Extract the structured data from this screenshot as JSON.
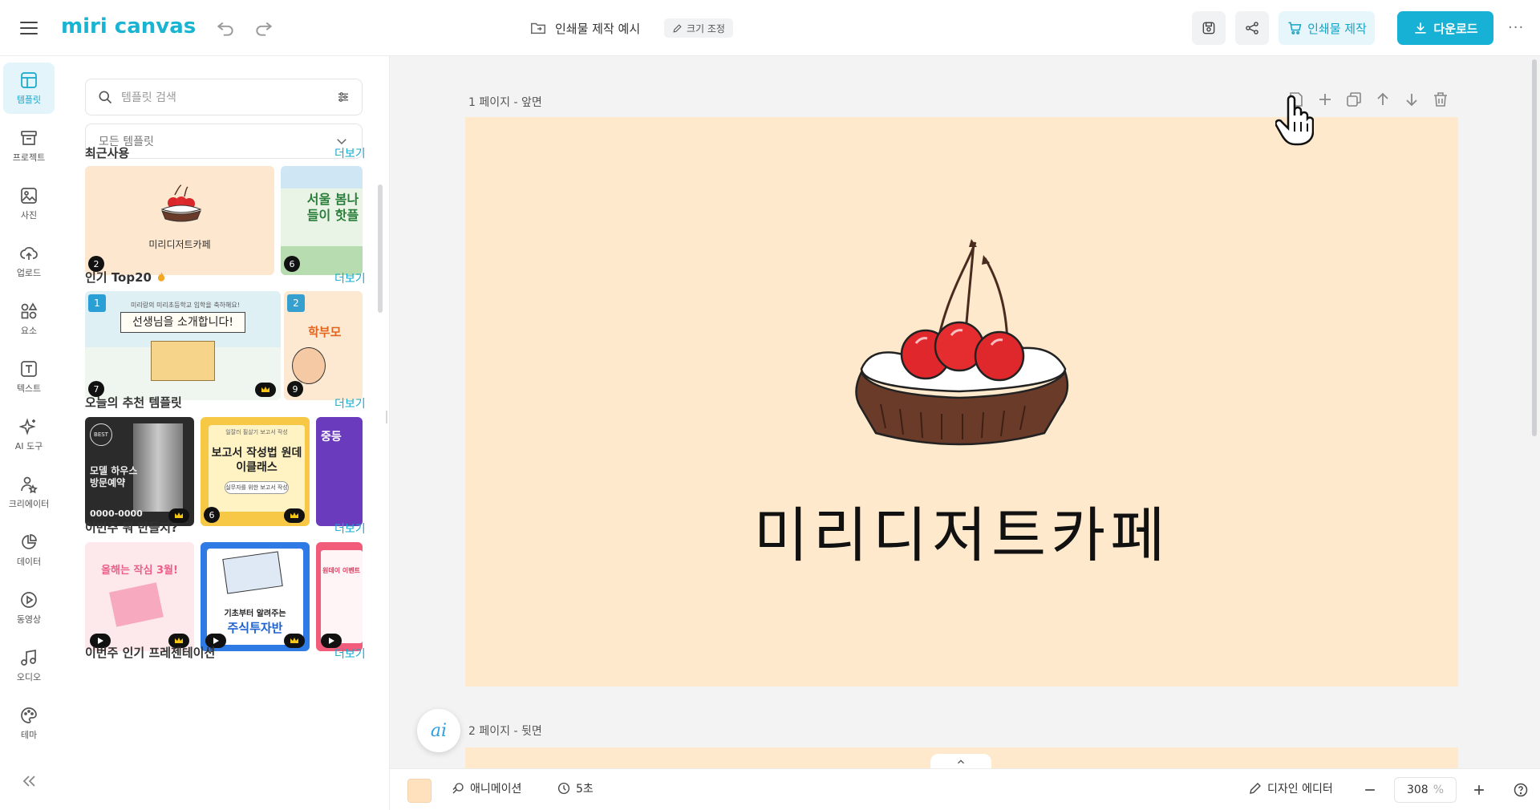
{
  "app": {
    "logo": "miri canvas",
    "doc_title": "인쇄물 제작 예시",
    "resize_label": "크기 조정",
    "print_label": "인쇄물 제작",
    "download_label": "다운로드",
    "more_label": "···"
  },
  "rail": {
    "items": [
      {
        "label": "템플릿",
        "icon": "template-icon",
        "active": true
      },
      {
        "label": "프로젝트",
        "icon": "project-icon"
      },
      {
        "label": "사진",
        "icon": "photo-icon"
      },
      {
        "label": "업로드",
        "icon": "upload-icon"
      },
      {
        "label": "요소",
        "icon": "elements-icon"
      },
      {
        "label": "텍스트",
        "icon": "text-icon"
      },
      {
        "label": "AI 도구",
        "icon": "ai-tools-icon"
      },
      {
        "label": "크리에이터",
        "icon": "creator-icon"
      },
      {
        "label": "데이터",
        "icon": "data-icon"
      },
      {
        "label": "동영상",
        "icon": "video-icon"
      },
      {
        "label": "오디오",
        "icon": "audio-icon"
      },
      {
        "label": "테마",
        "icon": "theme-icon"
      }
    ]
  },
  "panel": {
    "search_placeholder": "템플릿 검색",
    "dropdown_value": "모든 템플릿",
    "more_label": "더보기",
    "sections": [
      {
        "title": "최근사용"
      },
      {
        "title": "인기 Top20"
      },
      {
        "title": "오늘의 추천 템플릿"
      },
      {
        "title": "이번주 뭐 만들지?"
      },
      {
        "title": "이번주 인기 프레젠테이션"
      }
    ],
    "recent": [
      {
        "text": "미리디저트카페",
        "count": "2"
      },
      {
        "text": "서울 봄나들이 핫플",
        "count": "6"
      }
    ],
    "top20": [
      {
        "rank": "1",
        "subtitle": "미리랑의 미리초등학교 입학을 축하해요!",
        "text": "선생님을 소개합니다!",
        "count": "7"
      },
      {
        "rank": "2",
        "text": "학부모",
        "count": "9"
      }
    ],
    "today": [
      {
        "text": "모델 하우스 방문예약",
        "phone": "0000-0000",
        "best": "BEST"
      },
      {
        "top": "일잘러 필살기 보고서 작성",
        "text": "보고서 작성법 원데이클래스",
        "sub": "실무자를 위한 보고서 작성",
        "count": "6"
      },
      {
        "text": "중등"
      }
    ],
    "weekly": [
      {
        "text": "올해는 작심 3월!"
      },
      {
        "top": "기초부터 알려주는",
        "text": "주식투자반"
      },
      {
        "text": "원데이 이벤트"
      }
    ]
  },
  "canvas": {
    "page1_label": "1 페이지 - 앞면",
    "page2_label": "2 페이지 - 뒷면",
    "title": "미리디저트카페",
    "bg_color": "#ffe9cc"
  },
  "bottom": {
    "animation_label": "애니메이션",
    "duration_label": "5초",
    "design_editor_label": "디자인 에디터",
    "zoom_value": "308",
    "zoom_unit": "%"
  },
  "colors": {
    "accent": "#16b1d4",
    "accent_light": "#e6f6fb",
    "canvas_bg": "#ffe9cc"
  }
}
